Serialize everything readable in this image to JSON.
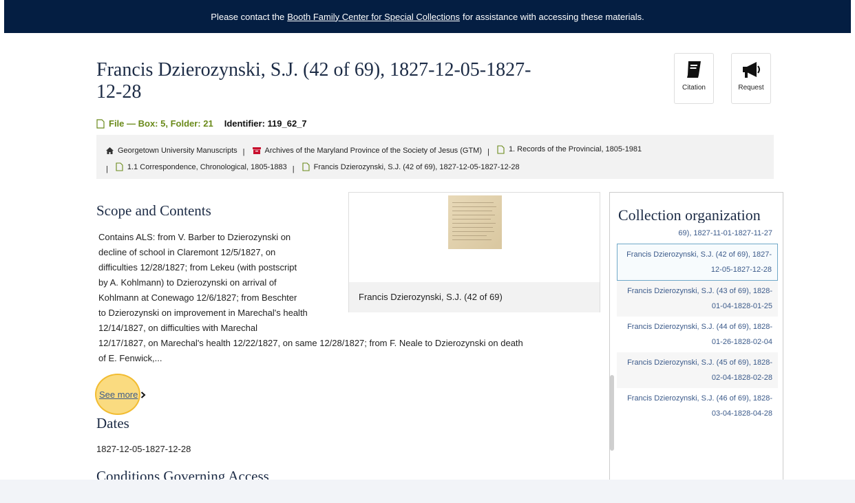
{
  "banner": {
    "pre": "Please contact the",
    "link": "Booth Family Center for Special Collections",
    "post": "for assistance with accessing these materials."
  },
  "title": "Francis Dzierozynski, S.J. (42 of 69), 1827-12-05-1827-12-28",
  "actions": {
    "citation": "Citation",
    "request": "Request"
  },
  "meta": {
    "type": "File — Box: 5, Folder: 21",
    "identifier": "Identifier: 119_62_7"
  },
  "breadcrumbs": [
    "Georgetown University Manuscripts",
    "Archives of the Maryland Province of the Society of Jesus (GTM)",
    "1. Records of the Provincial, 1805-1981",
    "1.1 Correspondence, Chronological, 1805-1883",
    "Francis Dzierozynski, S.J. (42 of 69), 1827-12-05-1827-12-28"
  ],
  "scope": {
    "heading": "Scope and Contents",
    "lines": [
      "Contains ALS: from V. Barber to Dzierozynski on",
      "decline of school in Claremont 12/5/1827, on",
      "difficulties 12/28/1827; from Lekeu (with postscript",
      "by A. Kohlmann) to Dzierozynski on arrival of",
      "Kohlmann at Conewago 12/6/1827; from Beschter",
      "to Dzierozynski on improvement in Marechal's health",
      "12/14/1827, on difficulties with Marechal",
      "12/17/1827, on Marechal's health 12/22/1827, on same 12/28/1827; from F. Neale to Dzierozynski on death",
      "of E. Fenwick,..."
    ],
    "see_more": "See more"
  },
  "dates": {
    "heading": "Dates",
    "value": "1827-12-05-1827-12-28"
  },
  "conditions_heading": "Conditions Governing Access",
  "thumbnail_caption": "Francis Dzierozynski, S.J. (42 of 69)",
  "organization": {
    "heading": "Collection organization",
    "items": [
      "69), 1827-11-01-1827-11-27",
      "Francis Dzierozynski, S.J. (42 of 69), 1827-12-05-1827-12-28",
      "Francis Dzierozynski, S.J. (43 of 69), 1828-01-04-1828-01-25",
      "Francis Dzierozynski, S.J. (44 of 69), 1828-01-26-1828-02-04",
      "Francis Dzierozynski, S.J. (45 of 69), 1828-02-04-1828-02-28",
      "Francis Dzierozynski, S.J. (46 of 69), 1828-03-04-1828-04-28"
    ]
  }
}
